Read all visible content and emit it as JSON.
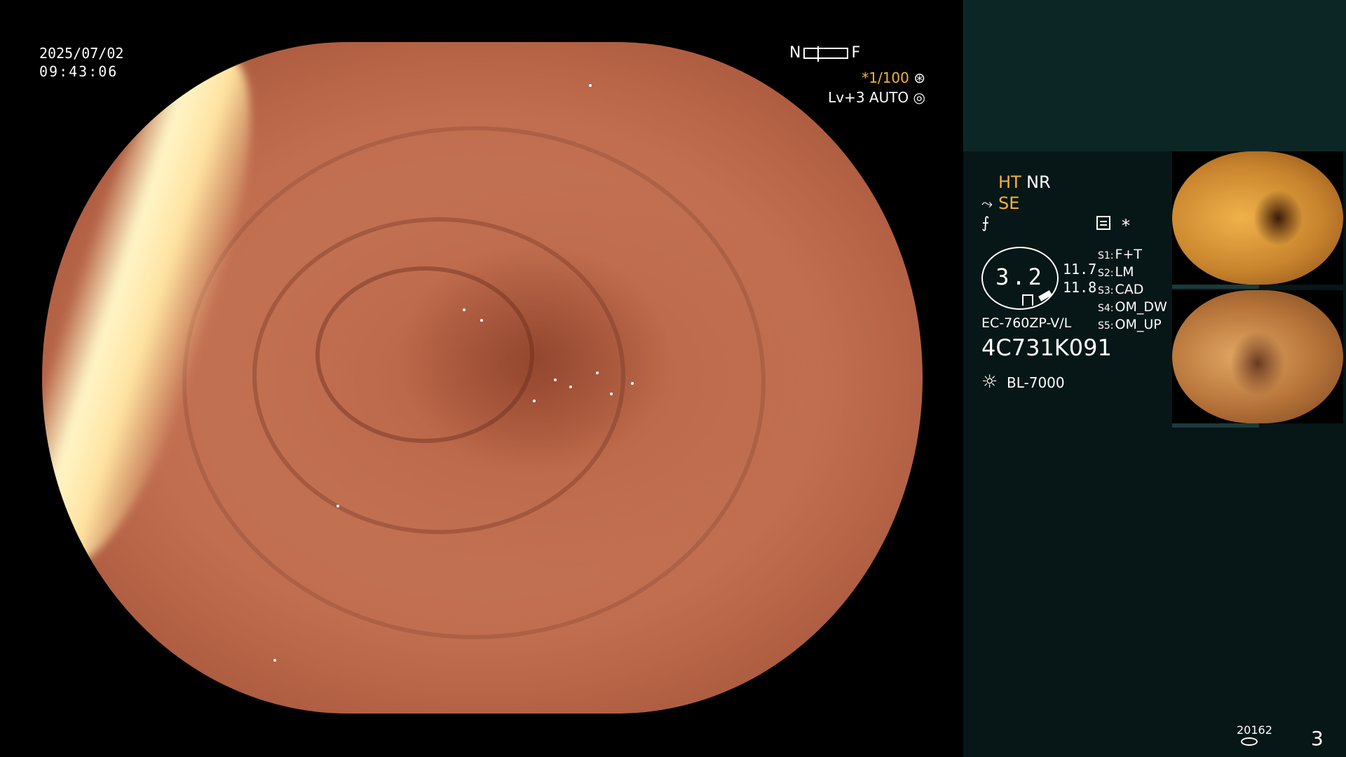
{
  "overlay": {
    "date": "2025/07/02",
    "time": "09:43:06",
    "near_label": "N",
    "far_label": "F",
    "shutter": "*1/100",
    "level": "Lv+3 AUTO"
  },
  "panel": {
    "ht": "HT",
    "nr": "NR",
    "se": "SE",
    "asterisk": "*",
    "gauge_value": "3.2",
    "value1": "11.7",
    "value2": "11.8",
    "settings": [
      {
        "key": "S1:",
        "value": "F+T"
      },
      {
        "key": "S2:",
        "value": "LM"
      },
      {
        "key": "S3:",
        "value": "CAD"
      },
      {
        "key": "S4:",
        "value": "OM_DW"
      },
      {
        "key": "S5:",
        "value": "OM_UP"
      }
    ],
    "model": "EC-760ZP-V/L",
    "serial": "4C731K091",
    "light_source": "BL-7000",
    "count": "20162",
    "page": "3"
  },
  "icons": {
    "aperture": "aperture-icon",
    "color": "color-mode-icon",
    "light": "light-source-icon",
    "freeze": "freeze-icon",
    "settings": "settings-icon",
    "disk": "disk-icon"
  },
  "colors": {
    "accent": "#f2b23c",
    "panel_bg": "#071616",
    "panel_top": "#0c2626"
  }
}
